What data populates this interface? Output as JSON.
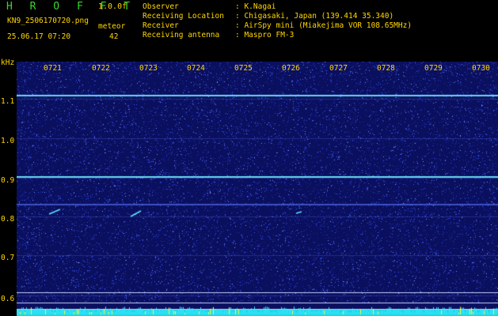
{
  "header": {
    "brand": "H R O F F T",
    "version": "1.0.0f",
    "filename": "KN9_2506170720.png",
    "meteor_label": "meteor",
    "datetime": "25.06.17 07:20",
    "meteor_count": "42",
    "info": [
      {
        "label": "Observer",
        "value": ": K.Nagai"
      },
      {
        "label": "Receiving Location",
        "value": ": Chigasaki, Japan (139.414 35.340)"
      },
      {
        "label": "Receiver",
        "value": ": AirSpy mini (Miakejima VOR 108.65MHz)"
      },
      {
        "label": "Receiving antenna",
        "value": ": Maspro FM-3"
      }
    ]
  },
  "plot": {
    "unit": "kHz",
    "y_ticks": [
      "1.1",
      "1.0",
      "0.9",
      "0.8",
      "0.7",
      "0.6"
    ],
    "x_ticks": [
      "0721",
      "0722",
      "0723",
      "0724",
      "0725",
      "0726",
      "0727",
      "0728",
      "0729",
      "0730"
    ],
    "background_color": "#0a0f5e",
    "noise_color": "#3a56ff",
    "carrier_color": "#6ff0ff",
    "label_color": "#ffd700"
  }
}
